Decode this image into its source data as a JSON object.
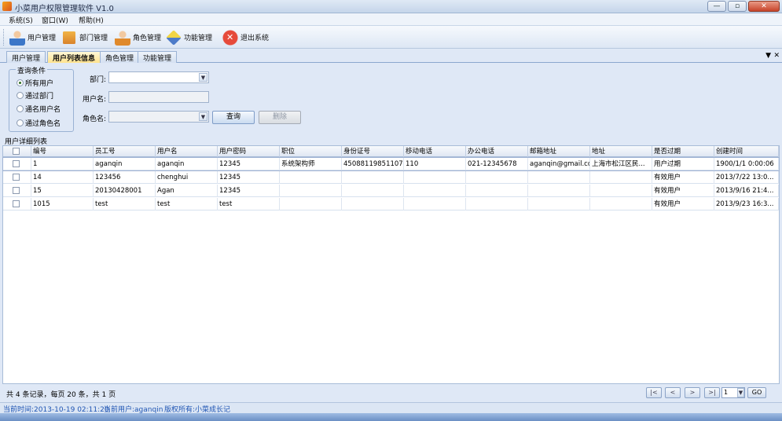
{
  "window": {
    "title": "小菜用户权限管理软件 V1.0",
    "controls": [
      "—",
      "▫",
      "✕"
    ]
  },
  "menu": [
    "系统(S)",
    "窗口(W)",
    "帮助(H)"
  ],
  "toolbar": [
    {
      "label": "用户管理",
      "icon": "user-icon"
    },
    {
      "label": "部门管理",
      "icon": "department-icon"
    },
    {
      "label": "角色管理",
      "icon": "role-icon"
    },
    {
      "label": "功能管理",
      "icon": "function-icon"
    },
    {
      "label": "退出系统",
      "icon": "exit-icon"
    }
  ],
  "tabs": [
    {
      "label": "用户管理",
      "active": false
    },
    {
      "label": "用户列表信息",
      "active": true
    },
    {
      "label": "角色管理",
      "active": false
    },
    {
      "label": "功能管理",
      "active": false
    }
  ],
  "tab_controls": {
    "dropdown": "▼",
    "close": "✕"
  },
  "filter": {
    "legend": "查询条件",
    "options": [
      "所有用户",
      "通过部门",
      "通名用户名",
      "通过角色名"
    ],
    "selected_index": 0,
    "department_label": "部门:",
    "username_label": "用户名:",
    "role_label": "角色名:",
    "query_button": "查询",
    "delete_button": "删除"
  },
  "grid": {
    "caption": "用户详细列表",
    "columns": [
      "编号",
      "员工号",
      "用户名",
      "用户密码",
      "职位",
      "身份证号",
      "移动电话",
      "办公电话",
      "邮箱地址",
      "地址",
      "是否过期",
      "创建时间"
    ],
    "rows": [
      [
        "1",
        "aganqin",
        "aganqin",
        "12345",
        "系统架构师",
        "45088119851107...",
        "110",
        "021-12345678",
        "aganqin@gmail.com",
        "上海市松江区民...",
        "用户过期",
        "1900/1/1 0:00:06"
      ],
      [
        "14",
        "123456",
        "chenghui",
        "12345",
        "",
        "",
        "",
        "",
        "",
        "",
        "有效用户",
        "2013/7/22 13:0..."
      ],
      [
        "15",
        "20130428001",
        "Agan",
        "12345",
        "",
        "",
        "",
        "",
        "",
        "",
        "有效用户",
        "2013/9/16 21:4..."
      ],
      [
        "1015",
        "test",
        "test",
        "test",
        "",
        "",
        "",
        "",
        "",
        "",
        "有效用户",
        "2013/9/23 16:3..."
      ]
    ]
  },
  "pager": {
    "summary": "共 4 条记录，每页 20 条，共 1 页",
    "first": "|<",
    "prev": "<",
    "next": ">",
    "last": ">|",
    "page": "1",
    "go": "GO"
  },
  "status": {
    "time": "当前时间:2013-10-19 02:11:20",
    "user": "当前用户:aganqin",
    "copyright": "版权所有:小菜成长记"
  }
}
